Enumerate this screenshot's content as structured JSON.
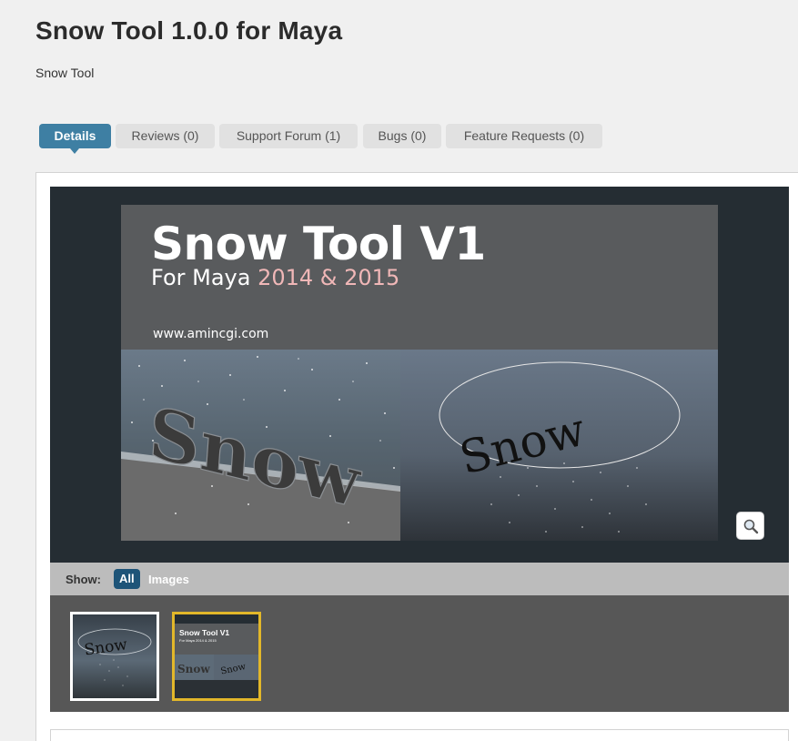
{
  "page": {
    "title": "Snow Tool 1.0.0 for Maya",
    "subtitle": "Snow Tool"
  },
  "tabs": [
    {
      "label": "Details",
      "active": true
    },
    {
      "label": "Reviews (0)",
      "active": false
    },
    {
      "label": "Support Forum (1)",
      "active": false
    },
    {
      "label": "Bugs (0)",
      "active": false
    },
    {
      "label": "Feature Requests (0)",
      "active": false
    }
  ],
  "main_image": {
    "headline": "Snow Tool V1",
    "subline_prefix": "For Maya",
    "subline_versions": "2014 & 2015",
    "url": "www.amincgi.com",
    "left_render_text": "Snow",
    "right_render_text": "Snow"
  },
  "gallery": {
    "show_label": "Show:",
    "filter_all": "All",
    "filter_images": "Images",
    "zoom_icon": "magnifier-icon"
  },
  "thumbnails": [
    {
      "text": "Snow",
      "selected": false
    },
    {
      "title": "Snow Tool V1",
      "sub": "For Maya 2014 & 2015",
      "text_left": "Snow",
      "text_right": "Snow",
      "selected": true
    }
  ],
  "colors": {
    "tab_active": "#3e7fa3",
    "filter_active": "#1e5478",
    "thumb_selected_border": "#e2b72a",
    "version_highlight": "#f0b7b7"
  }
}
